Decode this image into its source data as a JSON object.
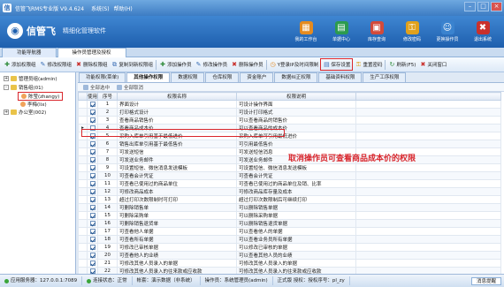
{
  "app": {
    "title": "信管飞RMS专业版 V9.4.624",
    "menu": [
      "系统(S)",
      "帮助(H)"
    ],
    "logo_name": "信管飞",
    "slogan": "精细化管理软件"
  },
  "quick_buttons": [
    {
      "label": "我的工作台",
      "icon": "desk-icon",
      "glyph": "▦",
      "color": "#e58b1f"
    },
    {
      "label": "单据中心",
      "icon": "document-icon",
      "glyph": "▤",
      "color": "#2c9b4e"
    },
    {
      "label": "库存查询",
      "icon": "stock-icon",
      "glyph": "▣",
      "color": "#d24a3a"
    },
    {
      "label": "修改密码",
      "icon": "lock-icon",
      "glyph": "⚿",
      "color": "#e0a11c"
    },
    {
      "label": "更换操作员",
      "icon": "users-icon",
      "glyph": "☺",
      "color": "#3a83cf"
    },
    {
      "label": "退出系统",
      "icon": "exit-icon",
      "glyph": "✖",
      "color": "#c9302c"
    }
  ],
  "main_tabs": [
    "功能导航器",
    "操作员管理及授权"
  ],
  "toolbar": [
    {
      "label": "添加权限组",
      "icon": "add-group-icon",
      "glyph": "✚",
      "color": "#2e8b3a"
    },
    {
      "label": "修改权限组",
      "icon": "edit-group-icon",
      "glyph": "✎",
      "color": "#3a6fb5"
    },
    {
      "label": "删除权限组",
      "icon": "delete-group-icon",
      "glyph": "✖",
      "color": "#c9302c"
    },
    {
      "label": "复制到新权限组",
      "icon": "copy-group-icon",
      "glyph": "⧉",
      "color": "#3a6fb5"
    },
    {
      "label": "添加操作员",
      "icon": "add-user-icon",
      "glyph": "✚",
      "color": "#2e8b3a"
    },
    {
      "label": "修改操作员",
      "icon": "edit-user-icon",
      "glyph": "✎",
      "color": "#3a6fb5"
    },
    {
      "label": "删除操作员",
      "icon": "delete-user-icon",
      "glyph": "✖",
      "color": "#c9302c"
    },
    {
      "label": "Y登录IP及时间限制",
      "icon": "ip-limit-icon",
      "glyph": "◷",
      "color": "#e58b1f"
    },
    {
      "label": "保存设置",
      "icon": "save-icon",
      "glyph": "▤",
      "color": "#3a6fb5"
    },
    {
      "label": "重置密码",
      "icon": "reset-password-icon",
      "glyph": "⚿",
      "color": "#e0a11c"
    },
    {
      "label": "刷新(F5)",
      "icon": "refresh-icon",
      "glyph": "↻",
      "color": "#2e8b3a"
    },
    {
      "label": "关闭窗口",
      "icon": "close-window-icon",
      "glyph": "✖",
      "color": "#c9302c"
    }
  ],
  "tree": {
    "nodes": [
      {
        "label": "管理员组(admin)",
        "level": 0,
        "kind": "folder",
        "toggle": "+"
      },
      {
        "label": "销售组(01)",
        "level": 0,
        "kind": "folder",
        "toggle": "-"
      },
      {
        "label": "陈莹(zhangy)",
        "level": 1,
        "kind": "person",
        "toggle": ""
      },
      {
        "label": "李梅(lix)",
        "level": 1,
        "kind": "person",
        "toggle": ""
      },
      {
        "label": "办公室(002)",
        "level": 0,
        "kind": "folder",
        "toggle": "+"
      }
    ]
  },
  "sub_tabs": [
    "功能权限(菜单)",
    "其他操作权限",
    "数据权限",
    "仓库权限",
    "资金账户",
    "数据纠正权限",
    "基础资料权限",
    "生产工序权限"
  ],
  "sub_toolbar": [
    "全部选中",
    "全部取消"
  ],
  "grid": {
    "columns": [
      "使用",
      "序号",
      "权限名称",
      "权限说明"
    ],
    "rows": [
      {
        "checked": true,
        "no": "1",
        "name": "界面设计",
        "desc": "可设计操作界面"
      },
      {
        "checked": true,
        "no": "2",
        "name": "打印格式设计",
        "desc": "可设计打印格式"
      },
      {
        "checked": true,
        "no": "3",
        "name": "查看商品销售价",
        "desc": "可以查看商品的销售价"
      },
      {
        "checked": false,
        "no": "4",
        "name": "查看商品成本价",
        "desc": "可以查看商品的成本价"
      },
      {
        "checked": true,
        "no": "5",
        "name": "采购入库单引用基于最低进价",
        "desc": "采购入库单可引用最低进价"
      },
      {
        "checked": true,
        "no": "6",
        "name": "销售出库单引用基于最低售价",
        "desc": "可引用最低售价"
      },
      {
        "checked": true,
        "no": "7",
        "name": "可发送短信",
        "desc": "可发送短信消息"
      },
      {
        "checked": true,
        "no": "8",
        "name": "可发送业务邮件",
        "desc": "可发送业务邮件"
      },
      {
        "checked": true,
        "no": "9",
        "name": "可设置短信、微信消息发送模板",
        "desc": "可设置短信、微信消息发送模板"
      },
      {
        "checked": true,
        "no": "10",
        "name": "可查看会计凭证",
        "desc": "可查看会计凭证"
      },
      {
        "checked": true,
        "no": "11",
        "name": "可查看已使用过的商品单位",
        "desc": "可查看已使用过的商品单位及销、比率"
      },
      {
        "checked": true,
        "no": "12",
        "name": "可修改商品成本",
        "desc": "可修改商品库存量及成本"
      },
      {
        "checked": true,
        "no": "13",
        "name": "超过打印次数限制时可打印",
        "desc": "超过打印次数限制后可继续打印"
      },
      {
        "checked": true,
        "no": "14",
        "name": "可删除销售单",
        "desc": "可以删除销售单据"
      },
      {
        "checked": true,
        "no": "15",
        "name": "可删除采购单",
        "desc": "可以删除采购单据"
      },
      {
        "checked": true,
        "no": "16",
        "name": "可删除销售退货单",
        "desc": "可以删除销售退货单据"
      },
      {
        "checked": true,
        "no": "17",
        "name": "可查看他人单据",
        "desc": "可以查看他人的单据"
      },
      {
        "checked": true,
        "no": "18",
        "name": "可查看所有单据",
        "desc": "可以查看业务员所有单据"
      },
      {
        "checked": true,
        "no": "19",
        "name": "可修改已审核单据",
        "desc": "可以修改已审核的单据"
      },
      {
        "checked": true,
        "no": "20",
        "name": "可查看他人的业绩",
        "desc": "可以查看其他人员的业绩"
      },
      {
        "checked": true,
        "no": "21",
        "name": "可修改其他人员录入的单据",
        "desc": "可修改其他人员录入的单据"
      },
      {
        "checked": true,
        "no": "22",
        "name": "可修改其他人员录入的往来款或应收款",
        "desc": "可修改其他人员录入的往来款或应收款"
      }
    ]
  },
  "callout": "取消操作员可查看商品成本价的权限",
  "status": {
    "server": "应用服务器：127.0.0.1:7089",
    "connection": "连接状态：正常",
    "account": "帐套：演示数据（非系统）",
    "operator": "操作员：系统管理员(admin)",
    "edition": "正式版  授权：授权序号：pl_zy",
    "right_button": "消息提醒"
  }
}
